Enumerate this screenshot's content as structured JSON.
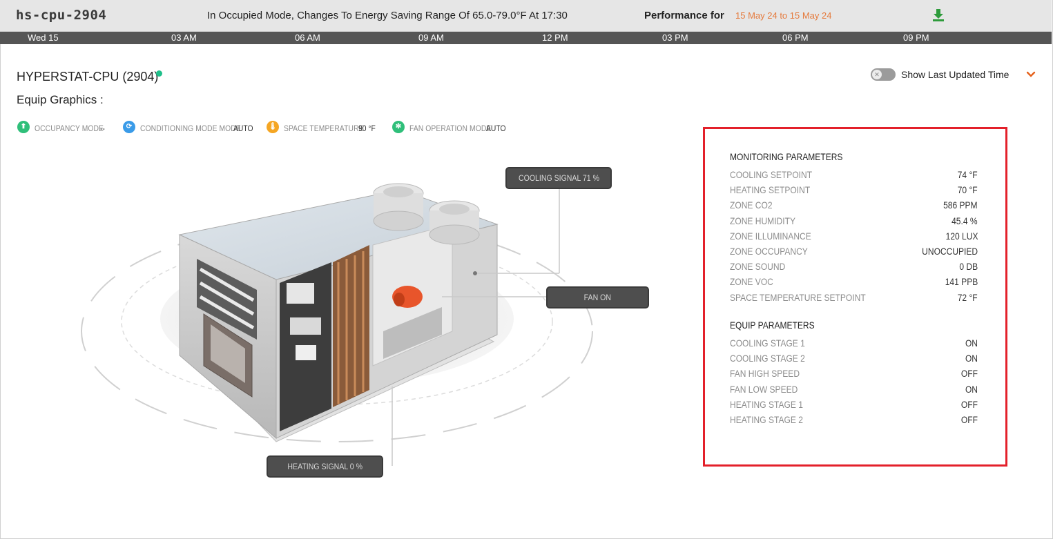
{
  "header": {
    "device_id": "hs-cpu-2904",
    "mode_message": "In Occupied Mode, Changes To Energy Saving Range Of 65.0-79.0°F At 17:30",
    "performance_label": "Performance for",
    "performance_range": "15 May 24 to 15 May 24",
    "download_icon": "download-icon"
  },
  "timeline": {
    "ticks": [
      "Wed 15",
      "03 AM",
      "06 AM",
      "09 AM",
      "12 PM",
      "03 PM",
      "06 PM",
      "09 PM"
    ]
  },
  "equip": {
    "title": "HYPERSTAT-CPU (2904)",
    "status_color": "#1fbf8a",
    "graphics_label": "Equip Graphics :",
    "toggle_label": "Show Last Updated Time",
    "toggle_on": false
  },
  "status": [
    {
      "icon": "occupancy-icon",
      "color": "#2fbf7a",
      "label": "OCCUPANCY MODE",
      "value": "--"
    },
    {
      "icon": "conditioning-icon",
      "color": "#3a9be8",
      "label": "CONDITIONING MODE MODE",
      "value": "AUTO"
    },
    {
      "icon": "temperature-icon",
      "color": "#f5a623",
      "label": "SPACE TEMPERATURE",
      "value": "90 °F"
    },
    {
      "icon": "fan-icon",
      "color": "#2fbf7a",
      "label": "FAN OPERATION MODE",
      "value": "AUTO"
    }
  ],
  "callouts": {
    "cooling": "COOLING SIGNAL 71 %",
    "fan": "FAN ON",
    "heating": "HEATING SIGNAL 0 %"
  },
  "monitoring": {
    "heading": "MONITORING PARAMETERS",
    "rows": [
      {
        "name": "COOLING SETPOINT",
        "value": "74 °F"
      },
      {
        "name": "HEATING SETPOINT",
        "value": "70 °F"
      },
      {
        "name": "ZONE CO2",
        "value": "586 PPM"
      },
      {
        "name": "ZONE HUMIDITY",
        "value": "45.4 %"
      },
      {
        "name": "ZONE ILLUMINANCE",
        "value": "120 LUX"
      },
      {
        "name": "ZONE OCCUPANCY",
        "value": "UNOCCUPIED"
      },
      {
        "name": "ZONE SOUND",
        "value": "0 DB"
      },
      {
        "name": "ZONE VOC",
        "value": "141 PPB"
      },
      {
        "name": "SPACE TEMPERATURE SETPOINT",
        "value": "72 °F"
      }
    ]
  },
  "equip_params": {
    "heading": "EQUIP PARAMETERS",
    "rows": [
      {
        "name": "COOLING STAGE 1",
        "value": "ON"
      },
      {
        "name": "COOLING STAGE 2",
        "value": "ON"
      },
      {
        "name": "FAN HIGH SPEED",
        "value": "OFF"
      },
      {
        "name": "FAN LOW SPEED",
        "value": "ON"
      },
      {
        "name": "HEATING STAGE 1",
        "value": "OFF"
      },
      {
        "name": "HEATING STAGE 2",
        "value": "OFF"
      }
    ]
  }
}
